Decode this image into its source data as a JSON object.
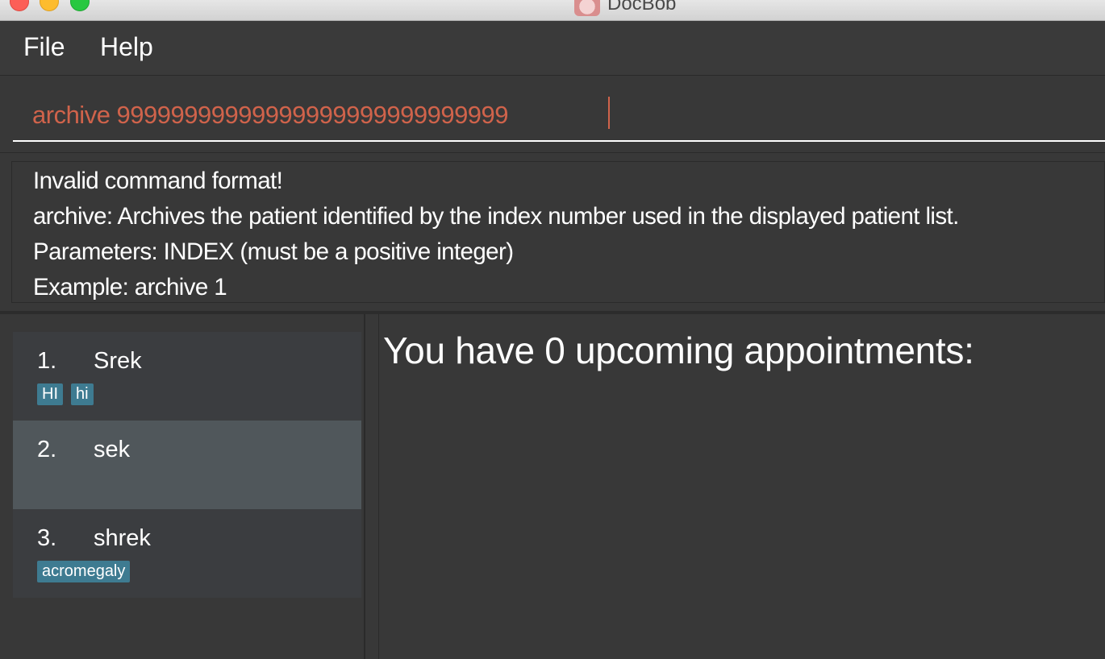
{
  "window": {
    "title": "DocBob"
  },
  "menu": {
    "file_label": "File",
    "help_label": "Help"
  },
  "command": {
    "value": "archive 99999999999999999999999999999"
  },
  "result": {
    "lines": [
      "Invalid command format!",
      "archive: Archives the patient identified by the index number used in the displayed patient list.",
      "Parameters: INDEX (must be a positive integer)",
      "Example: archive 1"
    ]
  },
  "patients": [
    {
      "index": "1.",
      "name": "Srek",
      "tags": [
        "HI",
        "hi"
      ]
    },
    {
      "index": "2.",
      "name": "sek",
      "tags": []
    },
    {
      "index": "3.",
      "name": "shrek",
      "tags": [
        "acromegaly"
      ]
    }
  ],
  "appointments": {
    "header": "You have 0 upcoming appointments:"
  },
  "colors": {
    "command_text": "#d0634b",
    "tag_bg": "#3e7b91",
    "selected_card": "#50575b"
  }
}
